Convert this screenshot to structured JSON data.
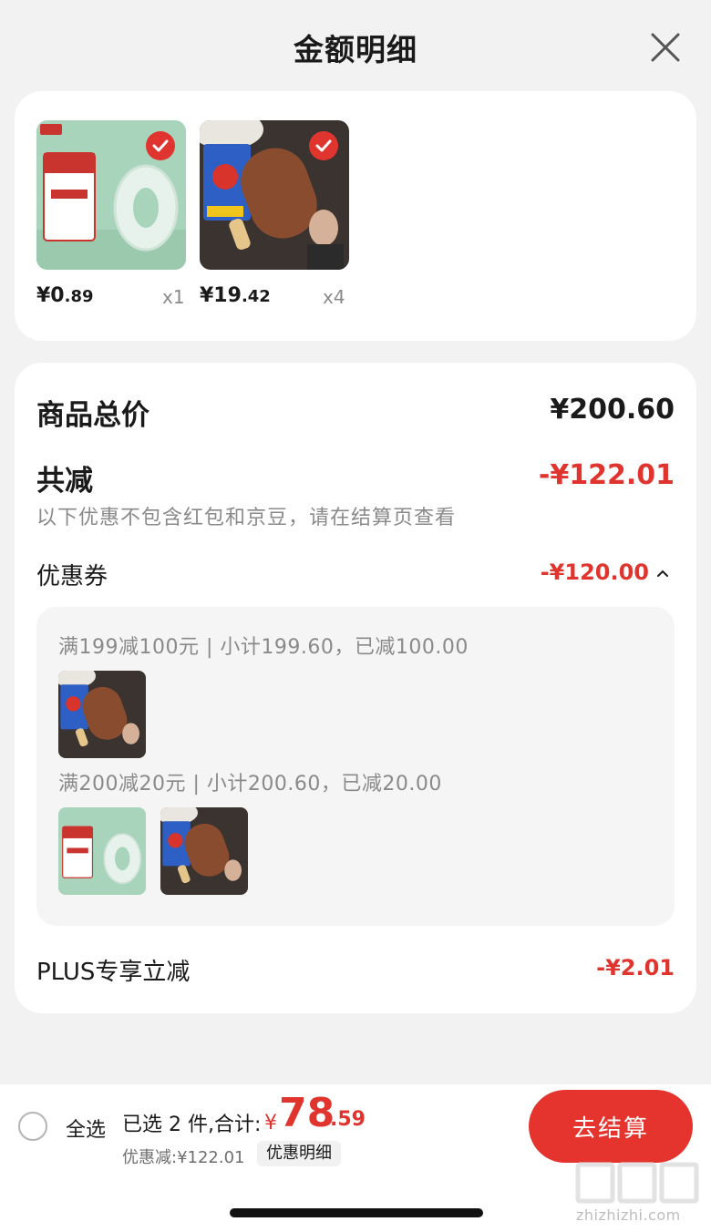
{
  "header": {
    "title": "金额明细"
  },
  "products": [
    {
      "price_int": "¥0",
      "price_dec": ".89",
      "qty": "x1",
      "image": "tape-product-image",
      "checked": true
    },
    {
      "price_int": "¥19",
      "price_dec": ".42",
      "qty": "x4",
      "image": "ice-cream-product-image",
      "checked": true
    }
  ],
  "summary": {
    "total_label": "商品总价",
    "total_value": "¥200.60",
    "reduce_label": "共减",
    "reduce_value": "-¥122.01",
    "note": "以下优惠不包含红包和京豆，请在结算页查看",
    "coupon_label": "优惠券",
    "coupon_value": "-¥120.00",
    "coupon_rules": [
      {
        "text": "满199减100元 | 小计199.60，已减100.00",
        "items": [
          "ice-cream-product-image"
        ]
      },
      {
        "text": "满200减20元 | 小计200.60，已减20.00",
        "items": [
          "tape-product-image",
          "ice-cream-product-image"
        ]
      }
    ],
    "plus_label": "PLUS专享立减",
    "plus_value": "-¥2.01"
  },
  "bottom": {
    "select_all": "全选",
    "selected_text": "已选 2 件,合计:",
    "total_symbol": "¥",
    "total_int": "78",
    "total_dec": ".59",
    "discount_text": "优惠减:¥122.01",
    "detail_label": "优惠明细",
    "checkout_label": "去结算",
    "watermark": "zhizhizhi.com"
  },
  "colors": {
    "accent_red": "#e0352f",
    "checkout_red": "#e5332e"
  }
}
